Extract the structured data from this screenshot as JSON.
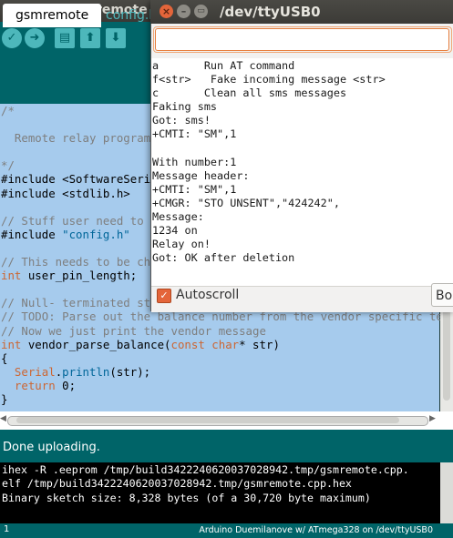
{
  "ide": {
    "title": "gsmremote |",
    "tabs": [
      "gsmremote",
      "config.h"
    ],
    "status": "Done uploading.",
    "console_lines": [
      "ihex -R .eeprom /tmp/build3422240620037028942.tmp/gsmremote.cpp.",
      "elf /tmp/build3422240620037028942.tmp/gsmremote.cpp.hex",
      "Binary sketch size: 8,328 bytes (of a 30,720 byte maximum)"
    ],
    "footer_line": "1",
    "footer_board": "Arduino Duemilanove w/ ATmega328 on /dev/ttyUSB0"
  },
  "serial_monitor": {
    "title": "/dev/ttyUSB0",
    "input_value": "",
    "output": "a       Run AT command\nf<str>   Fake incoming message <str>\nc       Clean all sms messages\nFaking sms\nGot: sms!\n+CMTI: \"SM\",1\n\nWith number:1\nMessage header:\n+CMTI: \"SM\",1\n+CMGR: \"STO UNSENT\",\"424242\",\nMessage:\n1234 on\nRelay on!\nGot: OK after deletion",
    "autoscroll_label": "Autoscroll",
    "autoscroll_checked": true,
    "baud_label": "Bo"
  },
  "icons": {
    "verify": "checkmark-icon",
    "upload": "arrow-right-icon",
    "new": "new-file-icon",
    "open": "arrow-up-icon",
    "save": "arrow-down-icon"
  },
  "colors": {
    "toolbar_teal": "#006468",
    "editor_selection": "#a6cbed",
    "window_close": "#e4653a"
  }
}
